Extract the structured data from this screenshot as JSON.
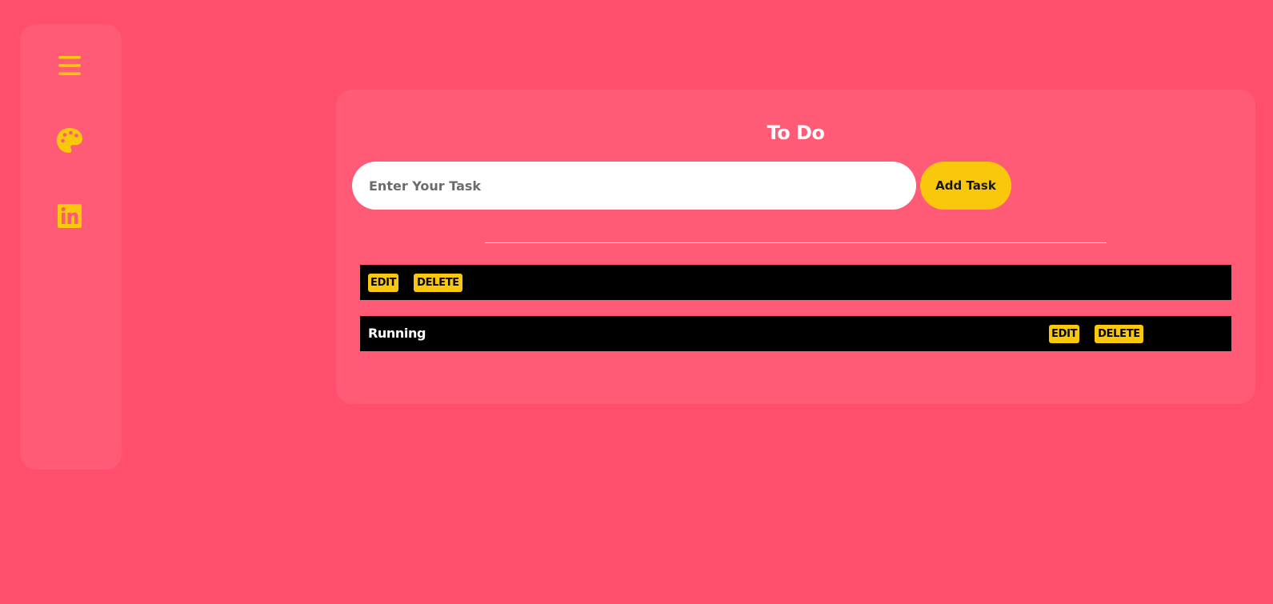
{
  "sidebar": {
    "icons": [
      "menu-icon",
      "palette-icon",
      "linkedin-icon"
    ],
    "accent": "#f9c70b"
  },
  "todo": {
    "title": "To Do",
    "input_placeholder": "Enter Your Task",
    "input_value": "",
    "add_label": "Add Task",
    "tasks": [
      {
        "text": "",
        "edit_label": "EDIT",
        "delete_label": "DELETE"
      },
      {
        "text": "Running",
        "edit_label": "EDIT",
        "delete_label": "DELETE"
      }
    ]
  },
  "colors": {
    "background": "#ff4f6d",
    "panel": "#ff5b76",
    "accent": "#f9c70b",
    "row": "#000000"
  }
}
